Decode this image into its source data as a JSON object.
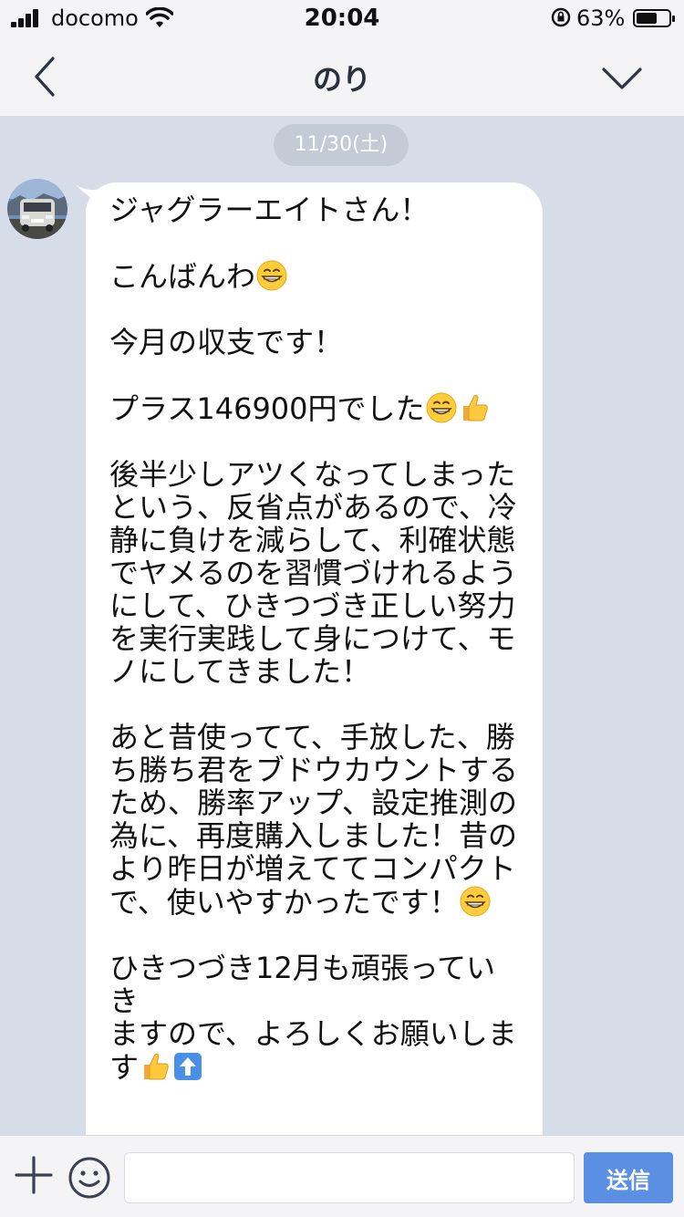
{
  "status_bar": {
    "carrier": "docomo",
    "time": "20:04",
    "battery_percent": "63%"
  },
  "nav": {
    "title": "のり",
    "back_icon": "chevron-left-icon",
    "dropdown_icon": "chevron-down-icon"
  },
  "chat": {
    "date": "11/30(土)",
    "message": {
      "lines": [
        "ジャグラーエイトさん！",
        "",
        "こんばんわ",
        "",
        "今月の収支です！",
        "",
        "プラス146900円でした",
        "",
        "後半少しアツくなってしまった",
        "という、反省点があるので、冷",
        "静に負けを減らして、利確状態",
        "でヤメるのを習慣づけれるよう",
        "にして、ひきつづき正しい努力",
        "を実行実践して身につけて、モ",
        "ノにしてきました！",
        "",
        "あと昔使ってて、手放した、勝",
        "ち勝ち君をブドウカウントする",
        "ため、勝率アップ、設定推測の",
        "為に、再度購入しました！昔の",
        "より昨日が増えててコンパクト",
        "で、使いやすかったです！",
        "",
        "ひきつづき12月も頑張っていき",
        "ますので、よろしくお願いしま",
        "す"
      ]
    }
  },
  "input_bar": {
    "placeholder": "",
    "send_label": "送信"
  },
  "colors": {
    "chat_background": "#d6dde9",
    "send_button": "#5b8fe4",
    "date_pill": "#c3cbd7"
  }
}
